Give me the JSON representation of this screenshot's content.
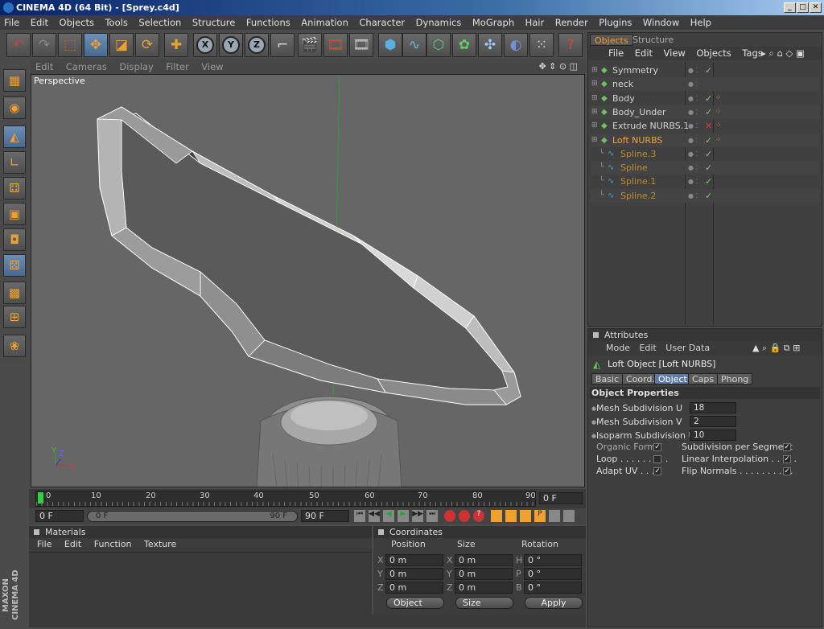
{
  "window": {
    "title": "CINEMA 4D (64 Bit) - [Sprey.c4d]"
  },
  "menubar": [
    "File",
    "Edit",
    "Objects",
    "Tools",
    "Selection",
    "Structure",
    "Functions",
    "Animation",
    "Character",
    "Dynamics",
    "MoGraph",
    "Hair",
    "Render",
    "Plugins",
    "Window",
    "Help"
  ],
  "toolbar": {
    "icons": [
      "undo-icon",
      "redo-icon",
      "select-icon",
      "move-icon",
      "scale-icon",
      "rotate-icon",
      "add-icon",
      "x-axis-icon",
      "y-axis-icon",
      "z-axis-icon",
      "coordinate-system-icon",
      "render-view-icon",
      "render-picture-viewer-icon",
      "render-settings-icon",
      "cube-icon",
      "spline-pen-icon",
      "nurbs-icon",
      "array-icon",
      "deformer-icon",
      "scene-icon",
      "camera-icon",
      "emitter-icon",
      "help-icon"
    ],
    "axis_labels": [
      "X",
      "Y",
      "Z"
    ]
  },
  "viewport": {
    "menu": [
      "Edit",
      "Cameras",
      "Display",
      "Filter",
      "View"
    ],
    "label": "Perspective",
    "axes": {
      "y": "Y",
      "z": "Z",
      "x": "X"
    }
  },
  "timeline": {
    "ticks": [
      "0",
      "10",
      "20",
      "30",
      "40",
      "50",
      "60",
      "70",
      "80",
      "90"
    ],
    "current_frame": "0 F",
    "start_frame": "0 F",
    "range_start": "0 F",
    "range_end": "90 F",
    "end_frame": "90 F"
  },
  "materials": {
    "title": "Materials",
    "menu": [
      "File",
      "Edit",
      "Function",
      "Texture"
    ]
  },
  "coordinates": {
    "title": "Coordinates",
    "headers": [
      "Position",
      "Size",
      "Rotation"
    ],
    "rows": [
      {
        "pl": "X",
        "pv": "0 m",
        "sl": "X",
        "sv": "0 m",
        "rl": "H",
        "rv": "0 °"
      },
      {
        "pl": "Y",
        "pv": "0 m",
        "sl": "Y",
        "sv": "0 m",
        "rl": "P",
        "rv": "0 °"
      },
      {
        "pl": "Z",
        "pv": "0 m",
        "sl": "Z",
        "sv": "0 m",
        "rl": "B",
        "rv": "0 °"
      }
    ],
    "mode_dropdown": "Object",
    "size_dropdown": "Size",
    "apply": "Apply"
  },
  "objects_panel": {
    "tabs": [
      "Objects",
      "Structure"
    ],
    "menu": [
      "File",
      "Edit",
      "View",
      "Objects",
      "Tags"
    ],
    "items": [
      {
        "name": "Symmetry",
        "indent": 0,
        "color": "#d4d4d4",
        "check": "✓"
      },
      {
        "name": "neck",
        "indent": 0,
        "color": "#d4d4d4",
        "check": ""
      },
      {
        "name": "Body",
        "indent": 0,
        "color": "#d4d4d4",
        "check": "✓"
      },
      {
        "name": "Body_Under",
        "indent": 0,
        "color": "#d4d4d4",
        "check": "✓"
      },
      {
        "name": "Extrude NURBS.1",
        "indent": 0,
        "color": "#d4d4d4",
        "check": "✕"
      },
      {
        "name": "Loft NURBS",
        "indent": 0,
        "color": "#f0a040",
        "check": "✓"
      },
      {
        "name": "Spline.3",
        "indent": 1,
        "color": "#c08a30",
        "check": "✓"
      },
      {
        "name": "Spline",
        "indent": 1,
        "color": "#c08a30",
        "check": "✓"
      },
      {
        "name": "Spline.1",
        "indent": 1,
        "color": "#c08a30",
        "check": "✓"
      },
      {
        "name": "Spline.2",
        "indent": 1,
        "color": "#c08a30",
        "check": "✓"
      }
    ]
  },
  "attributes": {
    "title": "Attributes",
    "menu": [
      "Mode",
      "Edit",
      "User Data"
    ],
    "object_title": "Loft Object [Loft NURBS]",
    "tabs": [
      "Basic",
      "Coord.",
      "Object",
      "Caps",
      "Phong"
    ],
    "section": "Object Properties",
    "fields": [
      {
        "label": "Mesh Subdivision U",
        "value": "18"
      },
      {
        "label": "Mesh Subdivision V",
        "value": "2"
      },
      {
        "label": "Isoparm Subdivision U",
        "value": "10"
      }
    ],
    "checks_left": [
      {
        "label": "Organic Form",
        "checked": "✓"
      },
      {
        "label": "Loop . . . . . . . . .",
        "checked": ""
      },
      {
        "label": "Adapt UV . . . .",
        "checked": "✓"
      }
    ],
    "checks_right": [
      {
        "label": "Subdivision per Segment",
        "checked": "✓"
      },
      {
        "label": "Linear Interpolation . . . . .",
        "checked": "✓"
      },
      {
        "label": "Flip Normals . . . . . . . . . .",
        "checked": "✓"
      }
    ]
  },
  "branding": {
    "logo": "MAXON CINEMA 4D"
  }
}
